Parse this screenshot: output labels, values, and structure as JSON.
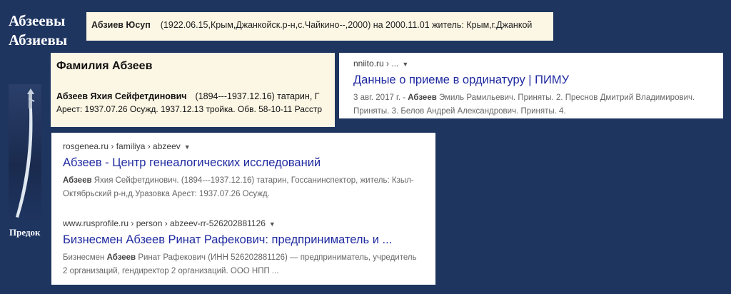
{
  "family": {
    "line1": "Абзеевы",
    "line2": "Абзиевы",
    "caption": "Предок"
  },
  "card1": {
    "name": "Абзиев Юсуп",
    "details": "(1922.06.15,Крым,Джанкойск.р-н,с.Чайкино--,2000) на 2000.11.01 житель: Крым,г.Джанкой"
  },
  "card2": {
    "heading": "Фамилия Абзеев",
    "name": "Абзеев Яхия Сейфетдинович",
    "details": "(1894---1937.12.16) татарин, Г",
    "line2": "Арест: 1937.07.26 Осужд. 1937.12.13 тройка. Обв. 58-10-11 Расстр"
  },
  "card3": {
    "cite": "nniito.ru › ...",
    "title": "Данные о приеме в ординатуру | ПИМУ",
    "date": "3 авг. 2017 г. - ",
    "bold": "Абзеев",
    "snippet": " Эмиль Рамильевич. Приняты. 2. Преснов Дмитрий Владимирович. Приняты. 3. Белов Андрей Александрович. Приняты. 4."
  },
  "card4": {
    "r1": {
      "cite": "rosgenea.ru › familiya › abzeev",
      "title": "Абзеев - Центр генеалогических исследований",
      "bold": "Абзеев",
      "snippet": " Яхия Сейфетдинович. (1894---1937.12.16) татарин, Госсанинспектор, житель: Кзыл-Октябрьский р-н,д.Уразовка Арест: 1937.07.26 Осужд."
    },
    "r2": {
      "cite": "www.rusprofile.ru › person › abzeev-rr-526202881126",
      "title": "Бизнесмен Абзеев Ринат Рафекович: предприниматель и ...",
      "pre": "Бизнесмен ",
      "bold": "Абзеев",
      "snippet": " Ринат Рафекович (ИНН 526202881126) — предприниматель, учредитель 2 организаций, гендиректор 2 организаций. ООО НПП ..."
    }
  }
}
